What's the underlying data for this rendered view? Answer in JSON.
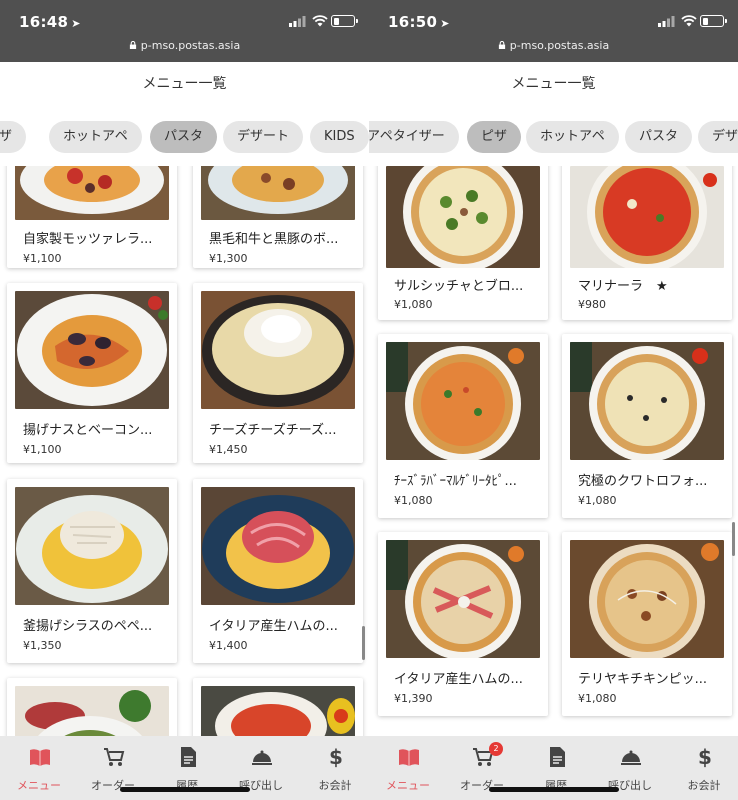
{
  "phones": [
    {
      "status": {
        "time": "16:48",
        "url": "p-mso.postas.asia",
        "battery_pct": 0.3
      },
      "title": "メニュー一覧",
      "categories": [
        "ピザ",
        "ホットアペ",
        "パスタ",
        "デザート",
        "KIDS"
      ],
      "active_category": "パスタ",
      "items": [
        {
          "name": "自家製モッツァレラ...",
          "price": "¥1,100"
        },
        {
          "name": "黒毛和牛と黒豚のボ...",
          "price": "¥1,300"
        },
        {
          "name": "揚げナスとベーコン...",
          "price": "¥1,100"
        },
        {
          "name": "チーズチーズチーズ...",
          "price": "¥1,450"
        },
        {
          "name": "釜揚げシラスのペペ...",
          "price": "¥1,350"
        },
        {
          "name": "イタリア産生ハムの...",
          "price": "¥1,400"
        },
        {
          "name": "",
          "price": ""
        },
        {
          "name": "",
          "price": ""
        }
      ],
      "tabs": [
        "メニュー",
        "オーダー",
        "履歴",
        "呼び出し",
        "お会計"
      ],
      "cart_badge": ""
    },
    {
      "status": {
        "time": "16:50",
        "url": "p-mso.postas.asia",
        "battery_pct": 0.3
      },
      "title": "メニュー一覧",
      "categories": [
        "アペタイザー",
        "ピザ",
        "ホットアペ",
        "パスタ",
        "デザ"
      ],
      "active_category": "ピザ",
      "items": [
        {
          "name": "サルシッチャとブロ...",
          "price": "¥1,080"
        },
        {
          "name": "マリナーラ　★",
          "price": "¥980"
        },
        {
          "name": "ﾁｰｽﾞﾗﾊﾞｰﾏﾙｹﾞﾘｰﾀﾋﾟ...",
          "price": "¥1,080"
        },
        {
          "name": "究極のクワトロフォ...",
          "price": "¥1,080"
        },
        {
          "name": "イタリア産生ハムの...",
          "price": "¥1,390"
        },
        {
          "name": "テリヤキチキンピッ...",
          "price": "¥1,080"
        }
      ],
      "tabs": [
        "メニュー",
        "オーダー",
        "履歴",
        "呼び出し",
        "お会計"
      ],
      "cart_badge": "2"
    }
  ],
  "colors": {
    "statusbar": "#505050",
    "accent": "#e0545b",
    "chip": "#e6e6e6",
    "chip_active": "#bdbdbd",
    "tabbar": "#e9e9e9"
  },
  "icons": [
    "location-arrow-icon",
    "lock-icon",
    "signal-icon",
    "wifi-icon",
    "battery-icon",
    "menu-book-icon",
    "cart-icon",
    "history-document-icon",
    "call-bell-icon",
    "dollar-icon"
  ]
}
